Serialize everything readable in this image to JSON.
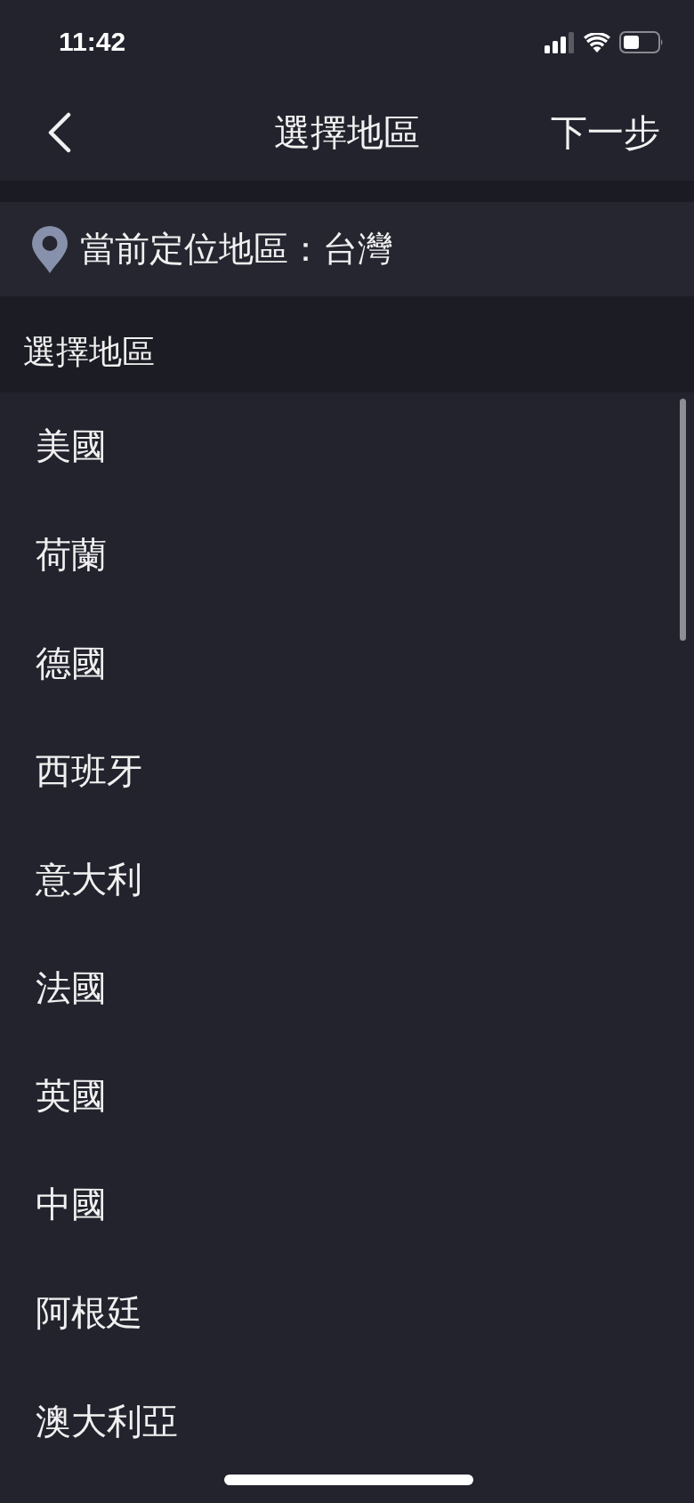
{
  "status_bar": {
    "time": "11:42"
  },
  "nav_bar": {
    "title": "選擇地區",
    "next": "下一步"
  },
  "current_location": {
    "text": "當前定位地區：台灣"
  },
  "section": {
    "title": "選擇地區"
  },
  "regions": [
    {
      "name": "美國"
    },
    {
      "name": "荷蘭"
    },
    {
      "name": "德國"
    },
    {
      "name": "西班牙"
    },
    {
      "name": "意大利"
    },
    {
      "name": "法國"
    },
    {
      "name": "英國"
    },
    {
      "name": "中國"
    },
    {
      "name": "阿根廷"
    },
    {
      "name": "澳大利亞"
    }
  ]
}
